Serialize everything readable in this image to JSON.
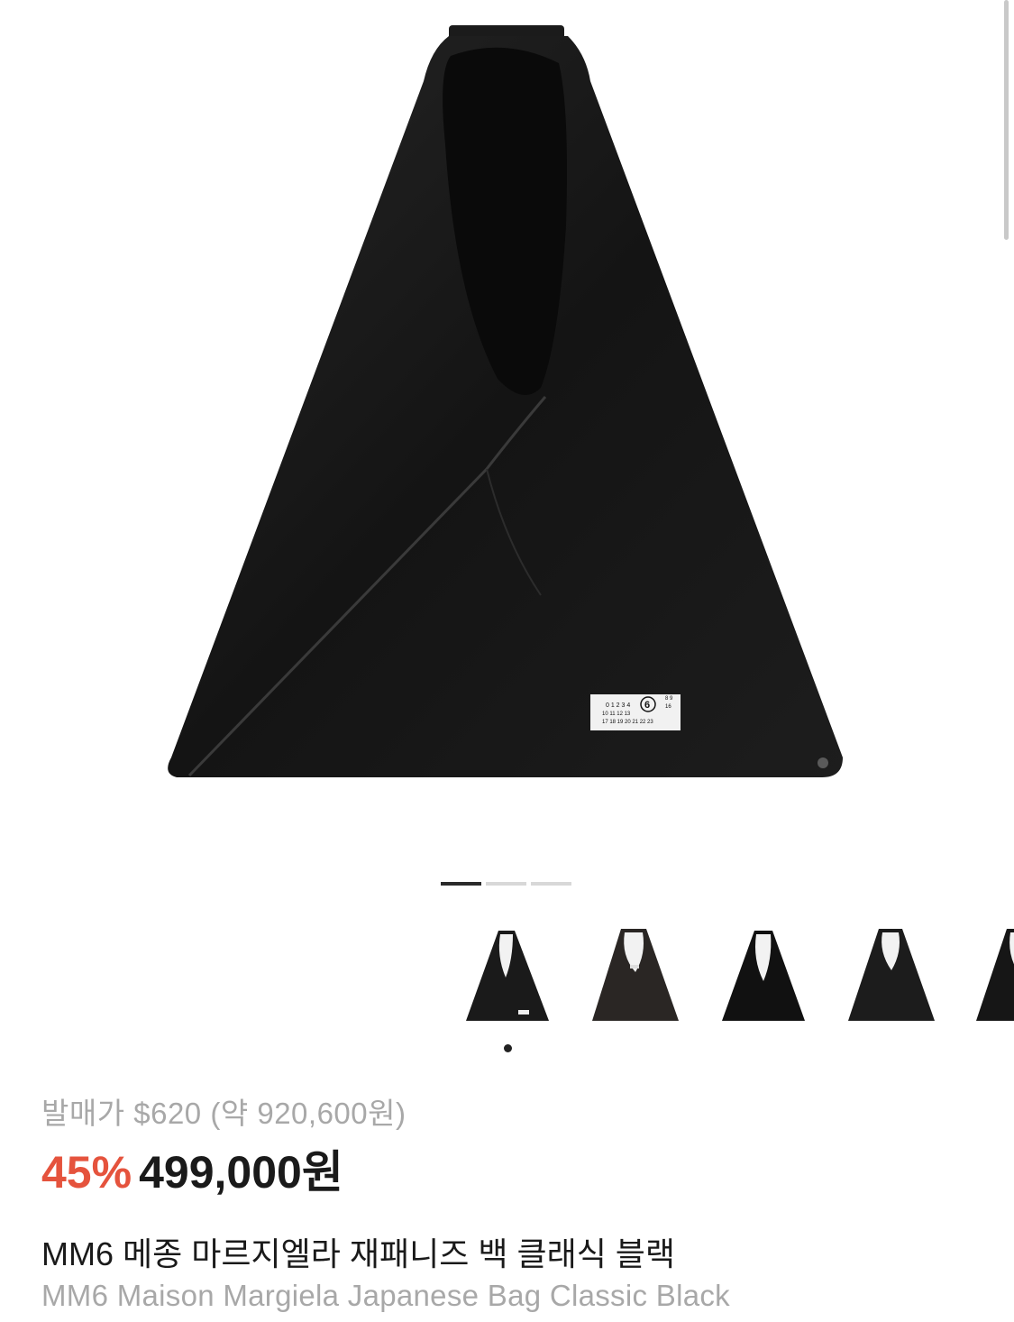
{
  "product": {
    "original_price": "발매가 $620 (약 920,600원)",
    "discount": "45%",
    "sale_price": "499,000원",
    "name_ko": "MM6 메종 마르지엘라 재패니즈 백 클래식 블랙",
    "name_en": "MM6 Maison Margiela Japanese Bag Classic Black"
  },
  "gallery": {
    "pages": 3,
    "current_page": 1,
    "thumbnails": [
      {
        "name": "thumb-1"
      },
      {
        "name": "thumb-2"
      },
      {
        "name": "thumb-3"
      },
      {
        "name": "thumb-4"
      },
      {
        "name": "thumb-5"
      }
    ],
    "selected_thumbnail": 1
  },
  "label": {
    "row1": "0 1 2 3 4",
    "row1b": "8 9",
    "row2": "10 11 12 13",
    "row2b": "16",
    "row3": "17 18 19 20 21 22 23",
    "circled": "6"
  },
  "colors": {
    "discount": "#e5533d",
    "bag": "#141414",
    "muted_text": "#a8a8a8"
  }
}
